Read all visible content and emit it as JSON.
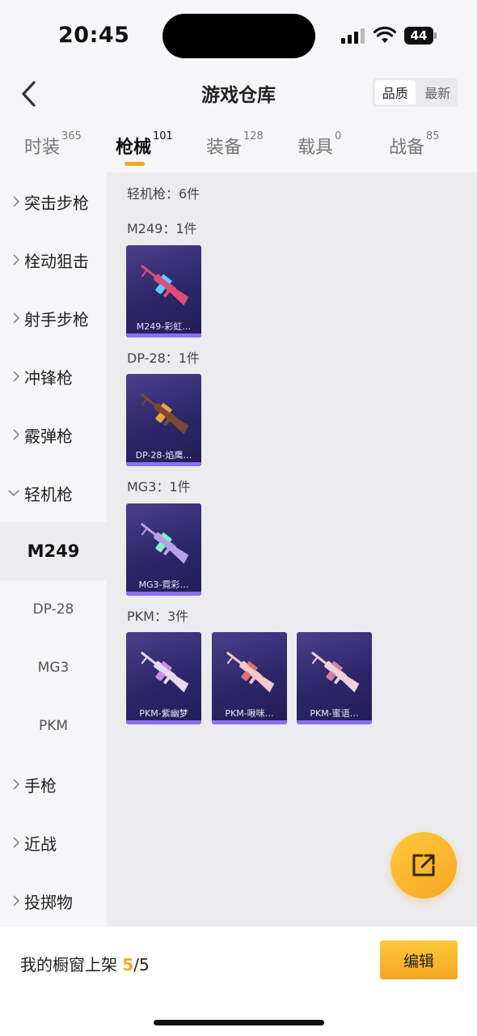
{
  "status": {
    "time": "20:45",
    "battery": "44"
  },
  "header": {
    "title": "游戏仓库",
    "sort_options": [
      "品质",
      "最新"
    ],
    "sort_active": "品质"
  },
  "tabs": [
    {
      "label": "时装",
      "count": "365"
    },
    {
      "label": "枪械",
      "count": "101"
    },
    {
      "label": "装备",
      "count": "128"
    },
    {
      "label": "载具",
      "count": "0"
    },
    {
      "label": "战备",
      "count": "85"
    }
  ],
  "sidebar": {
    "categories": [
      "突击步枪",
      "栓动狙击",
      "射手步枪",
      "冲锋枪",
      "霰弹枪",
      "轻机枪"
    ],
    "sub_items": [
      "M249",
      "DP-28",
      "MG3",
      "PKM"
    ],
    "more_categories": [
      "手枪",
      "近战",
      "投掷物"
    ]
  },
  "main": {
    "summary": "轻机枪：6件",
    "groups": [
      {
        "label": "M249：1件",
        "items": [
          {
            "caption": "M249-彩虹…",
            "gun_color": "#e04b7a",
            "accent": "#5ad0ff"
          }
        ]
      },
      {
        "label": "DP-28：1件",
        "items": [
          {
            "caption": "DP-28-焰鹰…",
            "gun_color": "#7a4a2a",
            "accent": "#f0a040"
          }
        ]
      },
      {
        "label": "MG3：1件",
        "items": [
          {
            "caption": "MG3-霓彩…",
            "gun_color": "#b7a0e8",
            "accent": "#7ef0c8"
          }
        ]
      },
      {
        "label": "PKM：3件",
        "items": [
          {
            "caption": "PKM-紫幽梦",
            "gun_color": "#e8d8f0",
            "accent": "#c090e0"
          },
          {
            "caption": "PKM-啾咪…",
            "gun_color": "#f2c8c8",
            "accent": "#e07070"
          },
          {
            "caption": "PKM-蜜语…",
            "gun_color": "#f0d0e0",
            "accent": "#d080a0"
          }
        ]
      }
    ]
  },
  "bottom": {
    "shelf_label": "我的橱窗上架",
    "shelf_current": "5",
    "shelf_total": "/5",
    "edit_label": "编辑"
  },
  "colors": {
    "accent": "#f5a623",
    "card_bg": "#2c2668"
  }
}
